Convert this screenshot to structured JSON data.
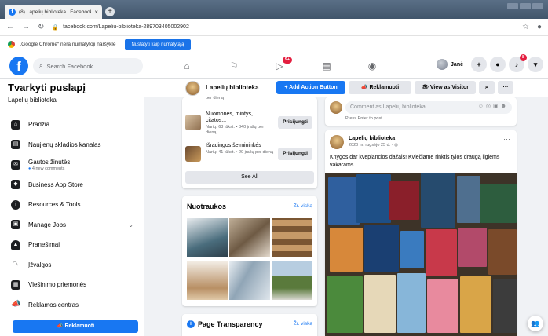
{
  "browser": {
    "tab_title": "(8) Lapelių biblioteka | Facebook",
    "new_tab": "+",
    "url": "facebook.com/Lapeliu-biblioteka-289703405002902",
    "infobar_message": "„Google Chrome“ nėra numatytoji naršyklė",
    "infobar_button": "Nustatyti kaip numatytąją"
  },
  "topbar": {
    "logo": "f",
    "search_placeholder": "Search Facebook",
    "video_badge": "9+",
    "user_name": "Janė",
    "notif_badge": "8"
  },
  "sidebar": {
    "title": "Tvarkyti puslapį",
    "subtitle": "Lapelių biblioteka",
    "items": [
      {
        "label": "Pradžia",
        "icon": "home-icon"
      },
      {
        "label": "Naujienų skladios kanalas",
        "icon": "news-feed-icon"
      },
      {
        "label": "Gautos žinutės",
        "sub": "4 new comments",
        "icon": "inbox-icon"
      },
      {
        "label": "Business App Store",
        "icon": "app-store-icon"
      },
      {
        "label": "Resources & Tools",
        "icon": "info-icon"
      },
      {
        "label": "Manage Jobs",
        "icon": "jobs-icon"
      },
      {
        "label": "Pranešimai",
        "icon": "bell-icon"
      },
      {
        "label": "Įžvalgos",
        "icon": "insights-icon"
      },
      {
        "label": "Viešinimo priemonės",
        "icon": "publishing-icon"
      },
      {
        "label": "Reklamos centras",
        "icon": "ad-center-icon"
      }
    ],
    "promote_button": "Reklamuoti"
  },
  "page_header": {
    "page_name": "Lapelių biblioteka",
    "add_action": "+ Add Action Button",
    "promote": "Reklamuoti",
    "view_as": "View as Visitor"
  },
  "groups": [
    {
      "name": "",
      "meta": "per dieną"
    },
    {
      "name": "Nuomonės, mintys, citatos...",
      "meta": "Narių: 63 tūkst. • 840 įrašų per dieną",
      "join": "Prisijungti"
    },
    {
      "name": "Išradingos šeimininkės",
      "meta": "Narių: 41 tūkst. • 20 įrašų per dieną",
      "join": "Prisijungti"
    }
  ],
  "see_all": "See All",
  "photos": {
    "title": "Nuotraukos",
    "link": "Žr. viską"
  },
  "transparency": {
    "title": "Page Transparency",
    "link": "Žr. viską"
  },
  "comment": {
    "placeholder": "Comment as Lapelių biblioteka",
    "hint": "Press Enter to post."
  },
  "post": {
    "author": "Lapelių biblioteka",
    "date": "2020 m. rugsėjo 25 d. ·",
    "text": "Knygos dar kvepiancios dažais! Kviečiame rinktis tylos draugą ilgiems vakarams."
  },
  "colors": {
    "fb_blue": "#1877f2",
    "badge_red": "#e41e3f"
  }
}
